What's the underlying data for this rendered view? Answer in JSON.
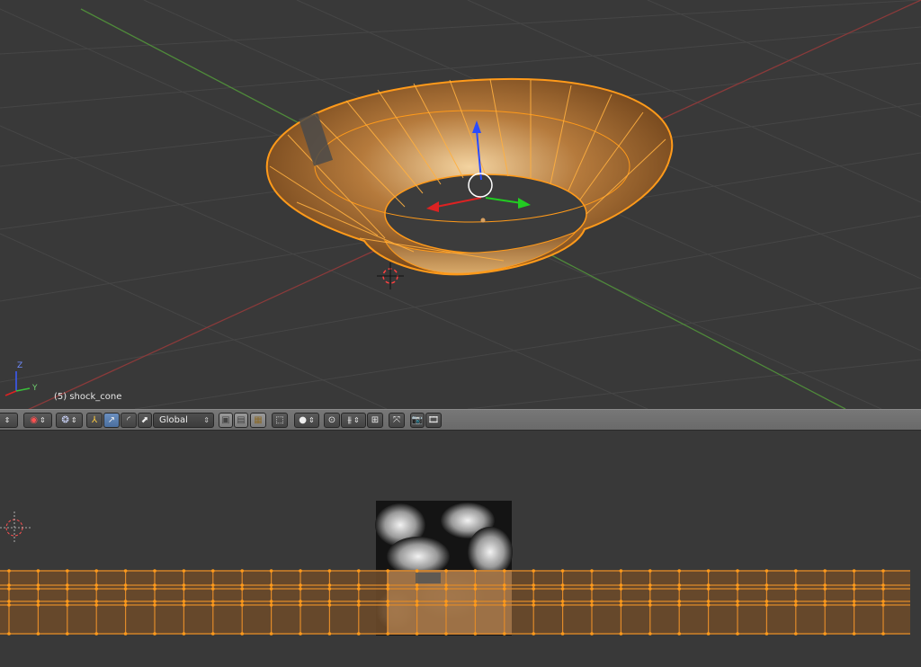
{
  "viewport": {
    "object_label": "(5) shock_cone",
    "axis_labels": {
      "z": "Z",
      "y": "Y"
    },
    "colors": {
      "background": "#393939",
      "grid": "#464646",
      "x_axis": "#8a3a3a",
      "y_axis": "#4f8a3a",
      "selection": "#ff9a1a",
      "manipulator_z": "#2a4cff",
      "manipulator_x": "#dd2222",
      "manipulator_y": "#22cc22"
    }
  },
  "toolbar": {
    "pivot_icon": "pivot-point-icon",
    "snap_icon": "proportional-edit-icon",
    "manipulator_translate_icon": "translate-manipulator-icon",
    "manipulator_rotate_icon": "rotate-manipulator-icon",
    "manipulator_scale_icon": "scale-manipulator-icon",
    "orientation_label": "Global",
    "layer_icons": [
      "vertex-select-icon",
      "edge-select-icon",
      "face-select-icon"
    ],
    "render_icons": [
      "render-icon",
      "render-animation-icon"
    ]
  },
  "uv_editor": {
    "colors": {
      "uv_fill": "#6b4a2a",
      "uv_edge": "#e08a2a",
      "uv_vertex": "#ff9a1a"
    }
  }
}
